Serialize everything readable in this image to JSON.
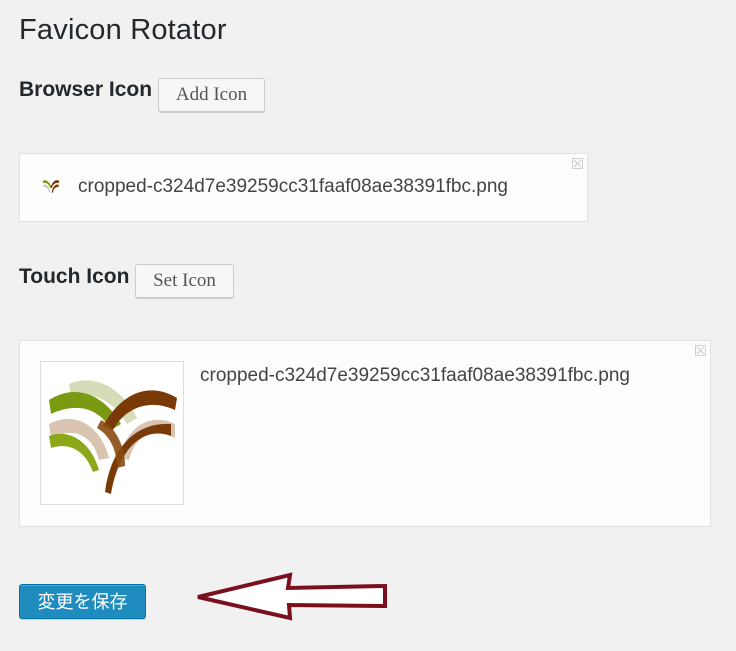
{
  "page": {
    "title": "Favicon Rotator"
  },
  "browser_icon": {
    "label": "Browser Icon",
    "button_label": "Add Icon",
    "file_name": "cropped-c324d7e39259cc31faaf08ae38391fbc.png",
    "remove_icon": "close-icon"
  },
  "touch_icon": {
    "label": "Touch Icon",
    "button_label": "Set Icon",
    "file_name": "cropped-c324d7e39259cc31faaf08ae38391fbc.png",
    "remove_icon": "close-icon"
  },
  "save": {
    "button_label": "変更を保存"
  },
  "colors": {
    "primary_button": "#1e8cbe",
    "annotation_arrow": "#7a0f1e",
    "logo_green": "#7a9a12",
    "logo_brown": "#7a3a08",
    "logo_tan": "#d8c4b0"
  }
}
